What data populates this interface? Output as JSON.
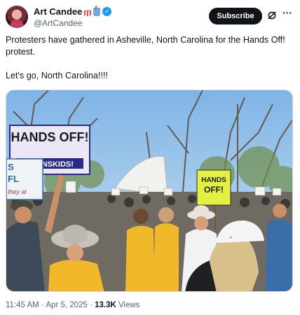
{
  "author": {
    "name": "Art Candee",
    "handle": "@ArtCandee",
    "badges": [
      "popcorn-icon",
      "cup-icon",
      "verified-badge-icon"
    ]
  },
  "actions": {
    "subscribe_label": "Subscribe",
    "grok_icon": "grok-icon",
    "more_icon": "more-icon"
  },
  "tweet": {
    "text_line1": "Protesters have gathered in Asheville, North Carolina for the Hands Off! protest.",
    "text_line2": "Let's go, North Carolina!!!!"
  },
  "media": {
    "sign_hands_off": "HANDS OFF!",
    "sign_transkids": "TRANSKIDS!",
    "sign_yellow_line1": "HANDS",
    "sign_yellow_line2": "OFF!",
    "sign_left_line1": "S",
    "sign_left_line2": "FL",
    "sign_left_line3": "they al"
  },
  "meta": {
    "time": "11:45 AM",
    "separator": "·",
    "date": "Apr 5, 2025",
    "views_count": "13.3K",
    "views_label": "Views"
  },
  "colors": {
    "accent": "#1d9bf0",
    "text": "#0f1419",
    "muted": "#536471",
    "button_bg": "#0f1419"
  }
}
